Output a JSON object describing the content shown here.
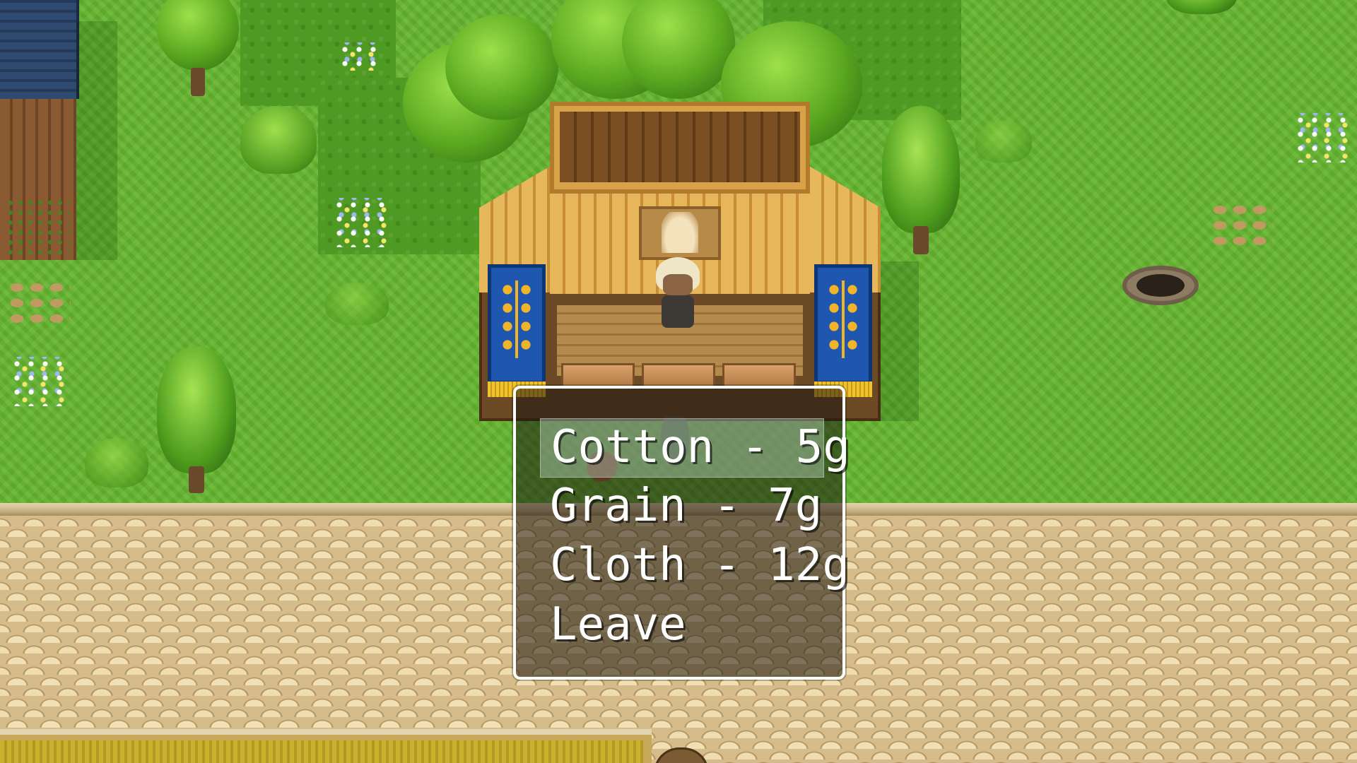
{
  "choice_menu": {
    "items": [
      {
        "label": "Cotton - 5g",
        "selected": true
      },
      {
        "label": "Grain - 7g",
        "selected": false
      },
      {
        "label": "Cloth - 12g",
        "selected": false
      },
      {
        "label": "Leave",
        "selected": false
      }
    ]
  }
}
